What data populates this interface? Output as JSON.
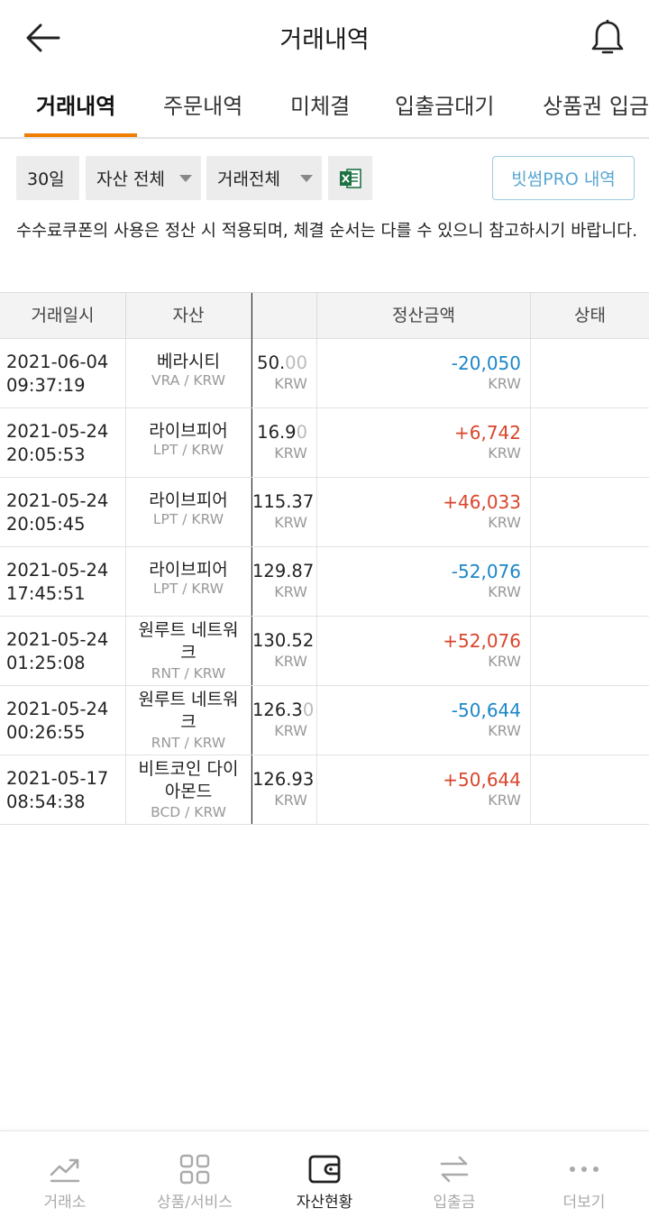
{
  "header": {
    "title": "거래내역",
    "back_icon": "arrow-left-icon",
    "bell_icon": "bell-icon"
  },
  "tabs": [
    {
      "label": "거래내역",
      "active": true
    },
    {
      "label": "주문내역"
    },
    {
      "label": "미체결"
    },
    {
      "label": "입출금대기"
    },
    {
      "label": "상품권 입금"
    }
  ],
  "filters": {
    "period": "30일",
    "asset": "자산 전체",
    "trade_type": "거래전체",
    "excel_icon": "excel-icon",
    "pro_button": "빗썸PRO 내역"
  },
  "notice": "수수료쿠폰의 사용은 정산 시 적용되며, 체결 순서는 다를 수 있으니 참고하시기 바랍니다.",
  "table": {
    "headers": [
      "거래일시",
      "자산",
      "",
      "정산금액",
      "상태"
    ],
    "rows": [
      {
        "date": "2021-06-04",
        "time": "09:37:19",
        "asset": "베라시티",
        "pair": "VRA / KRW",
        "price": "50.",
        "price_faded": "00",
        "price_unit": "KRW",
        "amount": "-20,050",
        "amount_unit": "KRW"
      },
      {
        "date": "2021-05-24",
        "time": "20:05:53",
        "asset": "라이브피어",
        "pair": "LPT / KRW",
        "price": "16.9",
        "price_faded": "0",
        "price_unit": "KRW",
        "amount": "+6,742",
        "amount_unit": "KRW"
      },
      {
        "date": "2021-05-24",
        "time": "20:05:45",
        "asset": "라이브피어",
        "pair": "LPT / KRW",
        "price": "115.37",
        "price_faded": "",
        "price_unit": "KRW",
        "amount": "+46,033",
        "amount_unit": "KRW"
      },
      {
        "date": "2021-05-24",
        "time": "17:45:51",
        "asset": "라이브피어",
        "pair": "LPT / KRW",
        "price": "129.87",
        "price_faded": "",
        "price_unit": "KRW",
        "amount": "-52,076",
        "amount_unit": "KRW"
      },
      {
        "date": "2021-05-24",
        "time": "01:25:08",
        "asset": "원루트 네트워크",
        "pair": "RNT / KRW",
        "price": "130.52",
        "price_faded": "",
        "price_unit": "KRW",
        "amount": "+52,076",
        "amount_unit": "KRW"
      },
      {
        "date": "2021-05-24",
        "time": "00:26:55",
        "asset": "원루트 네트워크",
        "pair": "RNT / KRW",
        "price": "126.3",
        "price_faded": "0",
        "price_unit": "KRW",
        "amount": "-50,644",
        "amount_unit": "KRW"
      },
      {
        "date": "2021-05-17",
        "time": "08:54:38",
        "asset": "비트코인 다이아몬드",
        "pair": "BCD / KRW",
        "price": "126.93",
        "price_faded": "",
        "price_unit": "KRW",
        "amount": "+50,644",
        "amount_unit": "KRW"
      }
    ]
  },
  "bottom_nav": [
    {
      "label": "거래소",
      "icon": "chart-line-icon"
    },
    {
      "label": "상품/서비스",
      "icon": "grid-icon"
    },
    {
      "label": "자산현황",
      "icon": "wallet-icon",
      "active": true
    },
    {
      "label": "입출금",
      "icon": "transfer-arrows-icon"
    },
    {
      "label": "더보기",
      "icon": "more-dots-icon"
    }
  ],
  "colors": {
    "accent": "#ee7d00",
    "negative": "#1c86c8",
    "positive": "#d9452b",
    "pro": "#5aa7d3"
  }
}
